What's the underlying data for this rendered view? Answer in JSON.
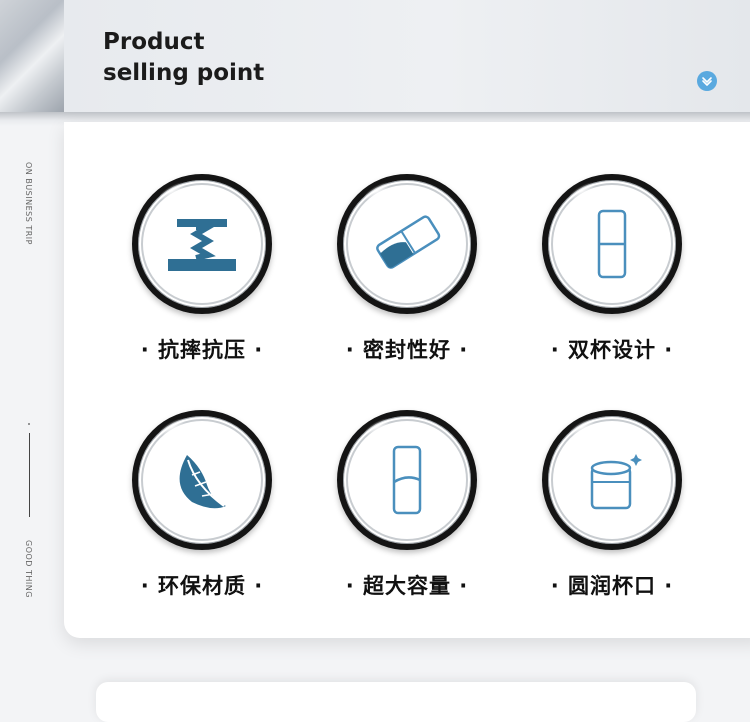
{
  "header": {
    "title_line1": "Product",
    "title_line2": "selling point",
    "chevron_icon": "chevron-down-icon",
    "accent": "#5aa9df"
  },
  "sidebar": {
    "top_text": "ON BUSINESS TRIP",
    "bottom_text": "GOOD THING"
  },
  "features": [
    {
      "label": "· 抗摔抗压 ·",
      "icon": "press-icon"
    },
    {
      "label": "· 密封性好 ·",
      "icon": "sealed-cup-icon"
    },
    {
      "label": "· 双杯设计 ·",
      "icon": "double-cup-icon"
    },
    {
      "label": "· 环保材质 ·",
      "icon": "leaf-icon"
    },
    {
      "label": "· 超大容量 ·",
      "icon": "capacity-cup-icon"
    },
    {
      "label": "· 圆润杯口 ·",
      "icon": "rounded-cup-icon"
    }
  ],
  "colors": {
    "icon_blue": "#2f6f94",
    "icon_outline": "#4a8fbd"
  }
}
